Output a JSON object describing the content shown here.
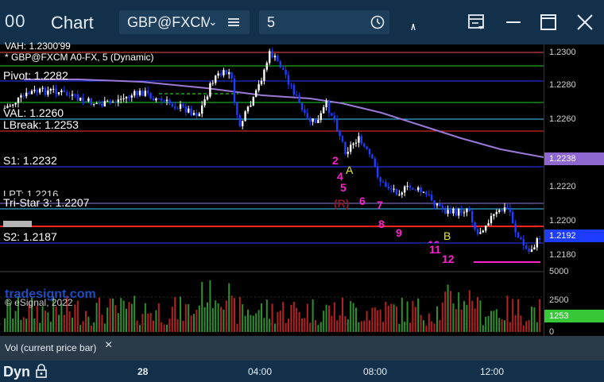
{
  "window": {
    "icon": "00",
    "title": "Chart",
    "symbol": "GBP@FXCM",
    "interval": "5",
    "colors": {
      "titlebar": "#12304a",
      "field": "#1e3f5c"
    }
  },
  "toolbar": {
    "symbol_menu_icon": "menu-icon",
    "interval_clock_icon": "clock-icon",
    "cursor_icon": "cursor-icon",
    "layout_icon": "layout-icon",
    "minimize_icon": "minimize-icon",
    "maximize_icon": "maximize-icon",
    "close_icon": "close-icon"
  },
  "chart": {
    "header_line1": "VAH: 1.2300'99",
    "header_line2": "* GBP@FXCM A0-FX, 5 (Dynamic)",
    "levels": {
      "pivot": "Pivot: 1.2282",
      "val": "VAL: 1.2260",
      "lbreak": "LBreak: 1.2253",
      "s1": "S1: 1.2232",
      "lpt": "LPT: 1.2216",
      "tristar": "Tri-Star 3: 1.2207",
      "s2": "S2: 1.2187"
    },
    "watermark": "tradesignt.com",
    "copyright": "© eSignal, 2022",
    "count_labels": [
      "2",
      "4",
      "5",
      "6",
      "7",
      "8",
      "9",
      "10",
      "11",
      "12"
    ],
    "letter_labels": {
      "A": "A",
      "B": "B",
      "R": "(R)"
    },
    "price_ticks": [
      "1.2300",
      "1.2280",
      "1.2260",
      "1.2240",
      "1.2220",
      "1.2200",
      "1.2180"
    ],
    "price_tags": {
      "ma": "1.2238",
      "last": "1.2192"
    },
    "volume_ticks": [
      "5000",
      "2500",
      "0"
    ],
    "volume_tag": "1253",
    "colors": {
      "up": "#ffffff",
      "down": "#1e3cff",
      "ma": "#9a79d8",
      "count": "#ff22cc",
      "setup": "#18a818",
      "volume_up": "#2f8f2f",
      "volume_down": "#b22222",
      "vol_tag": "#37c837",
      "ma_tag": "#8e68d0"
    }
  },
  "volume_panel": {
    "label": "Vol (current price bar)",
    "close": "×"
  },
  "timeline": {
    "mode": "Dyn",
    "lock_icon": "lock-icon",
    "labels": [
      "28",
      "04:00",
      "08:00",
      "12:00"
    ]
  }
}
